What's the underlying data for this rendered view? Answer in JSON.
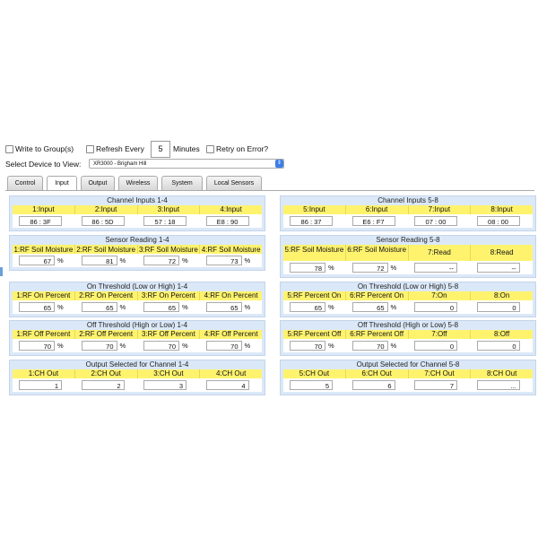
{
  "top": {
    "write_group": "Write to Group(s)",
    "refresh_every": "Refresh Every",
    "refresh_value": "5",
    "minutes": "Minutes",
    "retry_on_error": "Retry on Error?"
  },
  "device": {
    "label": "Select Device to View:",
    "selected": "XR3000 - Brigham Hill"
  },
  "tabs": [
    "Control",
    "Input",
    "Output",
    "Wireless",
    "System",
    "Local Sensors"
  ],
  "active_tab": "Input",
  "left": {
    "channel_inputs": {
      "title": "Channel Inputs 1-4",
      "headers": [
        "1:Input",
        "2:Input",
        "3:Input",
        "4:Input"
      ],
      "values": [
        "86 : 3F",
        "86 : 5D",
        "57 : 18",
        "E8 : 90"
      ]
    },
    "sensor_reading": {
      "title": "Sensor Reading 1-4",
      "headers": [
        "1:RF Soil Moisture",
        "2:RF Soil Moisture",
        "3:RF Soil Moisture",
        "4:RF Soil Moisture"
      ],
      "values": [
        "67",
        "81",
        "72",
        "73"
      ],
      "unit": "%"
    },
    "on_threshold": {
      "title": "On Threshold (Low or High) 1-4",
      "headers": [
        "1:RF On Percent",
        "2:RF On Percent",
        "3:RF On Percent",
        "4:RF On Percent"
      ],
      "values": [
        "65",
        "65",
        "65",
        "65"
      ],
      "unit": "%"
    },
    "off_threshold": {
      "title": "Off Threshold (High or Low) 1-4",
      "headers": [
        "1:RF Off Percent",
        "2:RF Off Percent",
        "3:RF Off Percent",
        "4:RF Off Percent"
      ],
      "values": [
        "70",
        "70",
        "70",
        "70"
      ],
      "unit": "%"
    },
    "output_selected": {
      "title": "Output Selected for Channel 1-4",
      "headers": [
        "1:CH Out",
        "2:CH Out",
        "3:CH Out",
        "4:CH Out"
      ],
      "values": [
        "1",
        "2",
        "3",
        "4"
      ]
    }
  },
  "right": {
    "channel_inputs": {
      "title": "Channel Inputs 5-8",
      "headers": [
        "5:Input",
        "6:Input",
        "7:Input",
        "8:Input"
      ],
      "values": [
        "86 : 37",
        "E6 : F7",
        "07 : 00",
        "08 : 00"
      ]
    },
    "sensor_reading": {
      "title": "Sensor Reading 5-8",
      "headers": [
        "5:RF Soil Moisture",
        "6:RF Soil Moisture",
        "7:Read",
        "8:Read"
      ],
      "values": [
        "78",
        "72",
        "--",
        "--"
      ],
      "unit": "%"
    },
    "on_threshold": {
      "title": "On Threshold (Low or High) 5-8",
      "headers": [
        "5:RF Percent On",
        "6:RF Percent On",
        "7:On",
        "8:On"
      ],
      "values": [
        "65",
        "65",
        "0",
        "0"
      ],
      "unit": "%"
    },
    "off_threshold": {
      "title": "Off Threshold (High or Low) 5-8",
      "headers": [
        "5:RF Percent Off",
        "6:RF Percent Off",
        "7:Off",
        "8:Off"
      ],
      "values": [
        "70",
        "70",
        "0",
        "0"
      ],
      "unit": "%"
    },
    "output_selected": {
      "title": "Output Selected for Channel 5-8",
      "headers": [
        "5:CH Out",
        "6:CH Out",
        "7:CH Out",
        "8:CH Out"
      ],
      "values": [
        "5",
        "6",
        "7",
        "..."
      ]
    }
  },
  "colors": {
    "panel_bg": "#dbe8f8",
    "header_bg": "#fff36e",
    "tab_active": "#ffffff",
    "select_arrow": "#3b7de8"
  }
}
